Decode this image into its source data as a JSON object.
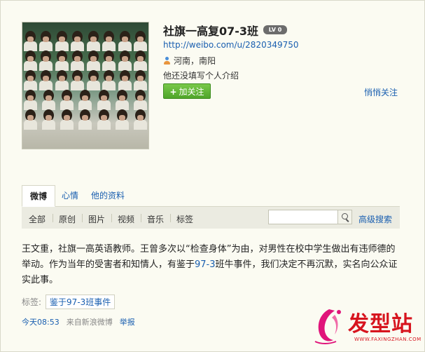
{
  "profile": {
    "name": "社旗一高复07-3班",
    "level_badge": "LV 0",
    "url": "http://weibo.com/u/2820349750",
    "location": "河南，南阳",
    "bio": "他还没填写个人介绍",
    "follow_button": "加关注",
    "quiet_follow": "悄悄关注"
  },
  "tabs": [
    "微博",
    "心情",
    "他的资料"
  ],
  "filters": [
    "全部",
    "原创",
    "图片",
    "视频",
    "音乐",
    "标签"
  ],
  "search": {
    "placeholder": "",
    "advanced_label": "高级搜索"
  },
  "post": {
    "text_before": "王文重，社旗一高英语教师。王曾多次以“检查身体”为由，对男性在校中学生做出有违师德的举动。作为当年的受害者和知情人，有鉴于",
    "highlight": "97-3",
    "text_after": "班牛事件，我们决定不再沉默，实名向公众证实此事。",
    "tags_label": "标签:",
    "tag": "鉴于97-3班事件",
    "time": "今天08:53",
    "source": "来自新浪微博",
    "report": "举报"
  },
  "watermark": {
    "main": "发型站",
    "sub": "WWW.FAXINGZHAN.COM"
  }
}
